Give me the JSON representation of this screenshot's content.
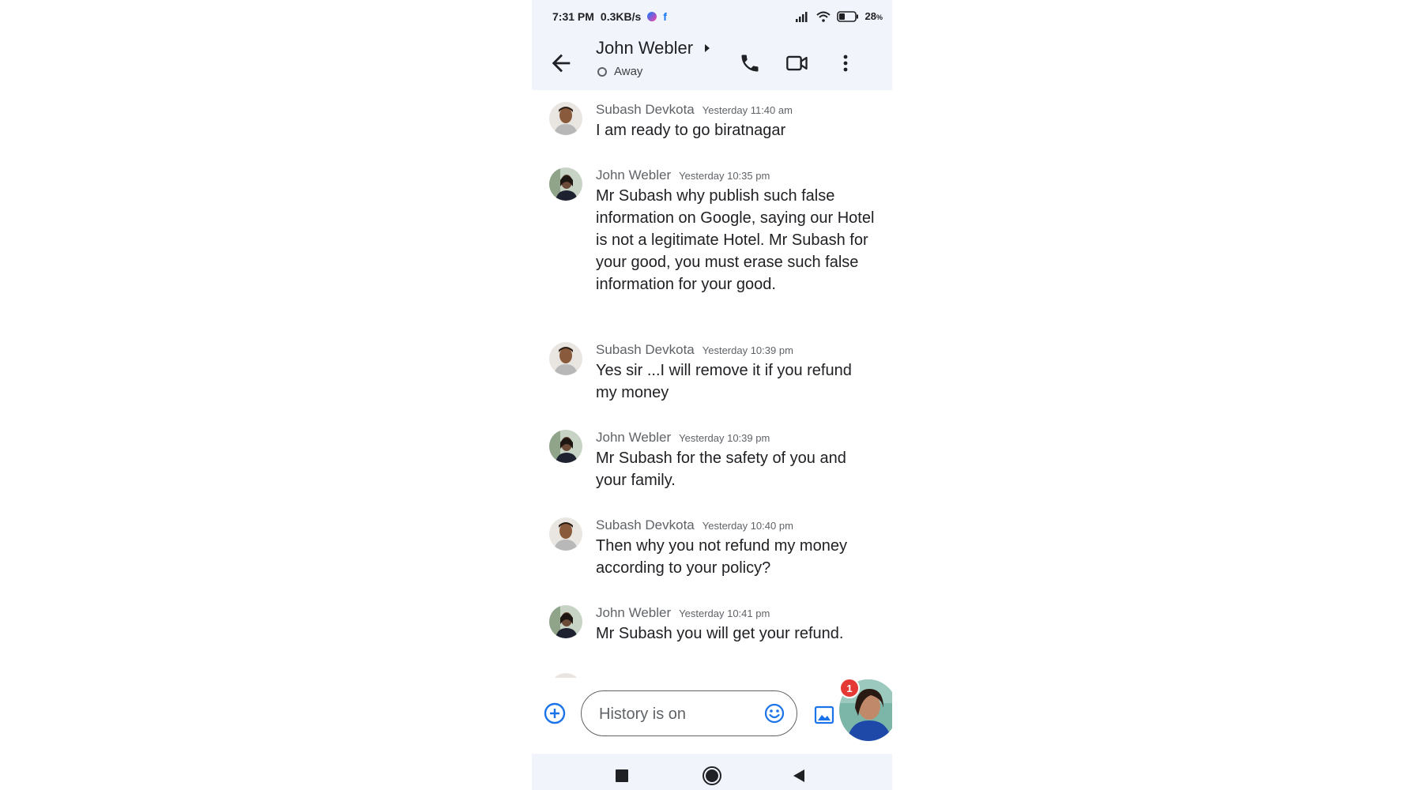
{
  "status_bar": {
    "time": "7:31 PM",
    "speed": "0.3KB/s",
    "battery": "28",
    "battery_unit": "%",
    "icons": [
      "messenger-icon",
      "facebook-icon",
      "signal-icon",
      "wifi-icon",
      "battery-icon"
    ]
  },
  "header": {
    "contact_name": "John Webler",
    "presence": "Away",
    "actions": [
      "back-arrow-icon",
      "phone-icon",
      "video-icon",
      "more-vert-icon"
    ]
  },
  "messages": [
    {
      "sender": "Subash Devkota",
      "time": "Yesterday 11:40 am",
      "text": "I am ready to go biratnagar"
    },
    {
      "sender": "John Webler",
      "time": "Yesterday 10:35 pm",
      "text": "Mr Subash why publish such false information on Google, saying our Hotel is not a legitimate Hotel. Mr Subash for your good, you must erase such false information for your good."
    },
    {
      "sender": "Subash Devkota",
      "time": "Yesterday 10:39 pm",
      "text": "Yes sir ...I will remove it if you refund my money"
    },
    {
      "sender": "John Webler",
      "time": "Yesterday 10:39 pm",
      "text": "Mr Subash for the safety of you and your family."
    },
    {
      "sender": "Subash Devkota",
      "time": "Yesterday 10:40 pm",
      "text": "Then why you not refund my money according to your policy?"
    },
    {
      "sender": "John Webler",
      "time": "Yesterday 10:41 pm",
      "text": "Mr Subash you will get your refund."
    }
  ],
  "compose": {
    "placeholder": "History is on",
    "badge_count": "1"
  },
  "colors": {
    "bar_bg": "#f1f4fb",
    "accent": "#1a73e8",
    "text": "#202124",
    "muted": "#5f6368",
    "badge": "#e53935"
  }
}
